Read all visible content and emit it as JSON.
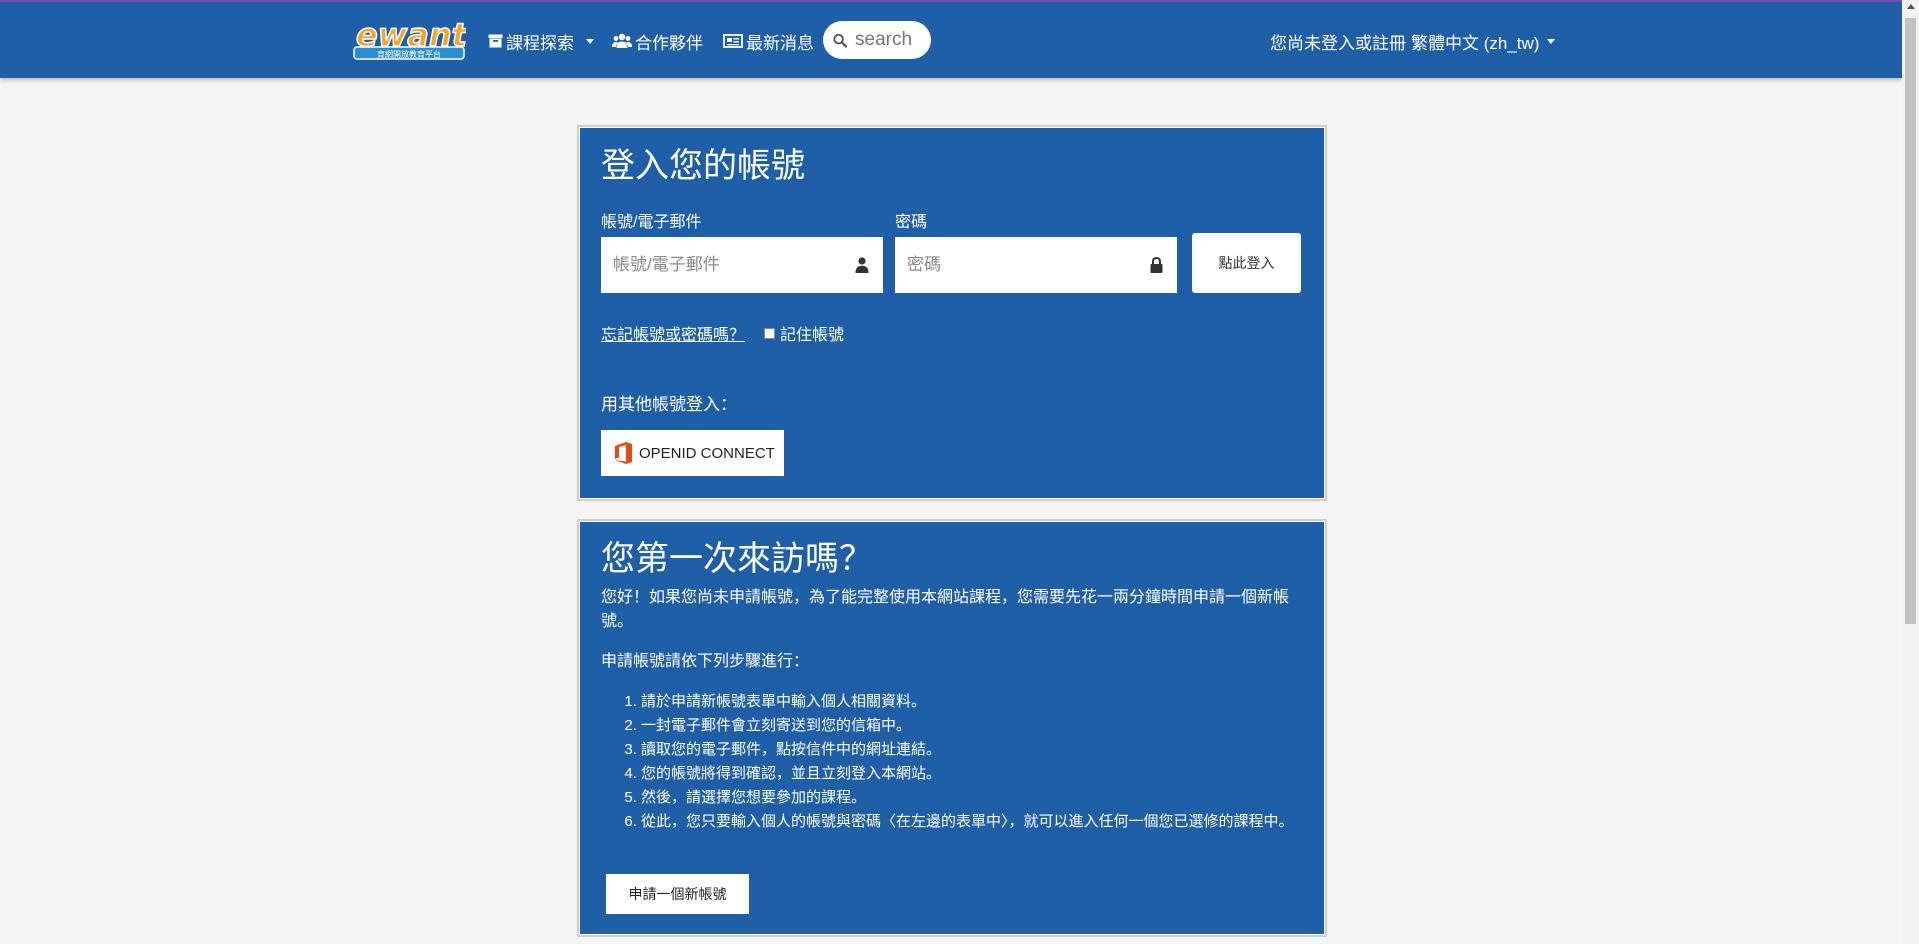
{
  "header": {
    "logo_text": "ewant",
    "logo_subtext": "育網開放教育平台",
    "nav": {
      "courses": "課程探索",
      "partners": "合作夥伴",
      "news": "最新消息"
    },
    "search_placeholder": "search",
    "login_status": "您尚未登入或註冊",
    "language": "繁體中文 (zh_tw)"
  },
  "login_card": {
    "title": "登入您的帳號",
    "username_label": "帳號/電子郵件",
    "username_placeholder": "帳號/電子郵件",
    "password_label": "密碼",
    "password_placeholder": "密碼",
    "login_button": "點此登入",
    "forgot_link": "忘記帳號或密碼嗎？",
    "remember_label": "記住帳號",
    "other_login_label": "用其他帳號登入：",
    "openid_button": "OPENID CONNECT"
  },
  "signup_card": {
    "title": "您第一次來訪嗎？",
    "intro": "您好！如果您尚未申請帳號，為了能完整使用本網站課程，您需要先花一兩分鐘時間申請一個新帳號。",
    "steps_intro": "申請帳號請依下列步驟進行：",
    "steps": [
      "請於申請新帳號表單中輸入個人相關資料。",
      "一封電子郵件會立刻寄送到您的信箱中。",
      "讀取您的電子郵件，點按信件中的網址連結。",
      "您的帳號將得到確認，並且立刻登入本網站。",
      "然後，請選擇您想要參加的課程。",
      "從此，您只要輸入個人的帳號與密碼〈在左邊的表單中〉，就可以進入任何一個您已選修的課程中。"
    ],
    "signup_button": "申請一個新帳號"
  },
  "colors": {
    "brand_blue": "#1f5fa8",
    "top_accent": "#7b4fb0"
  }
}
